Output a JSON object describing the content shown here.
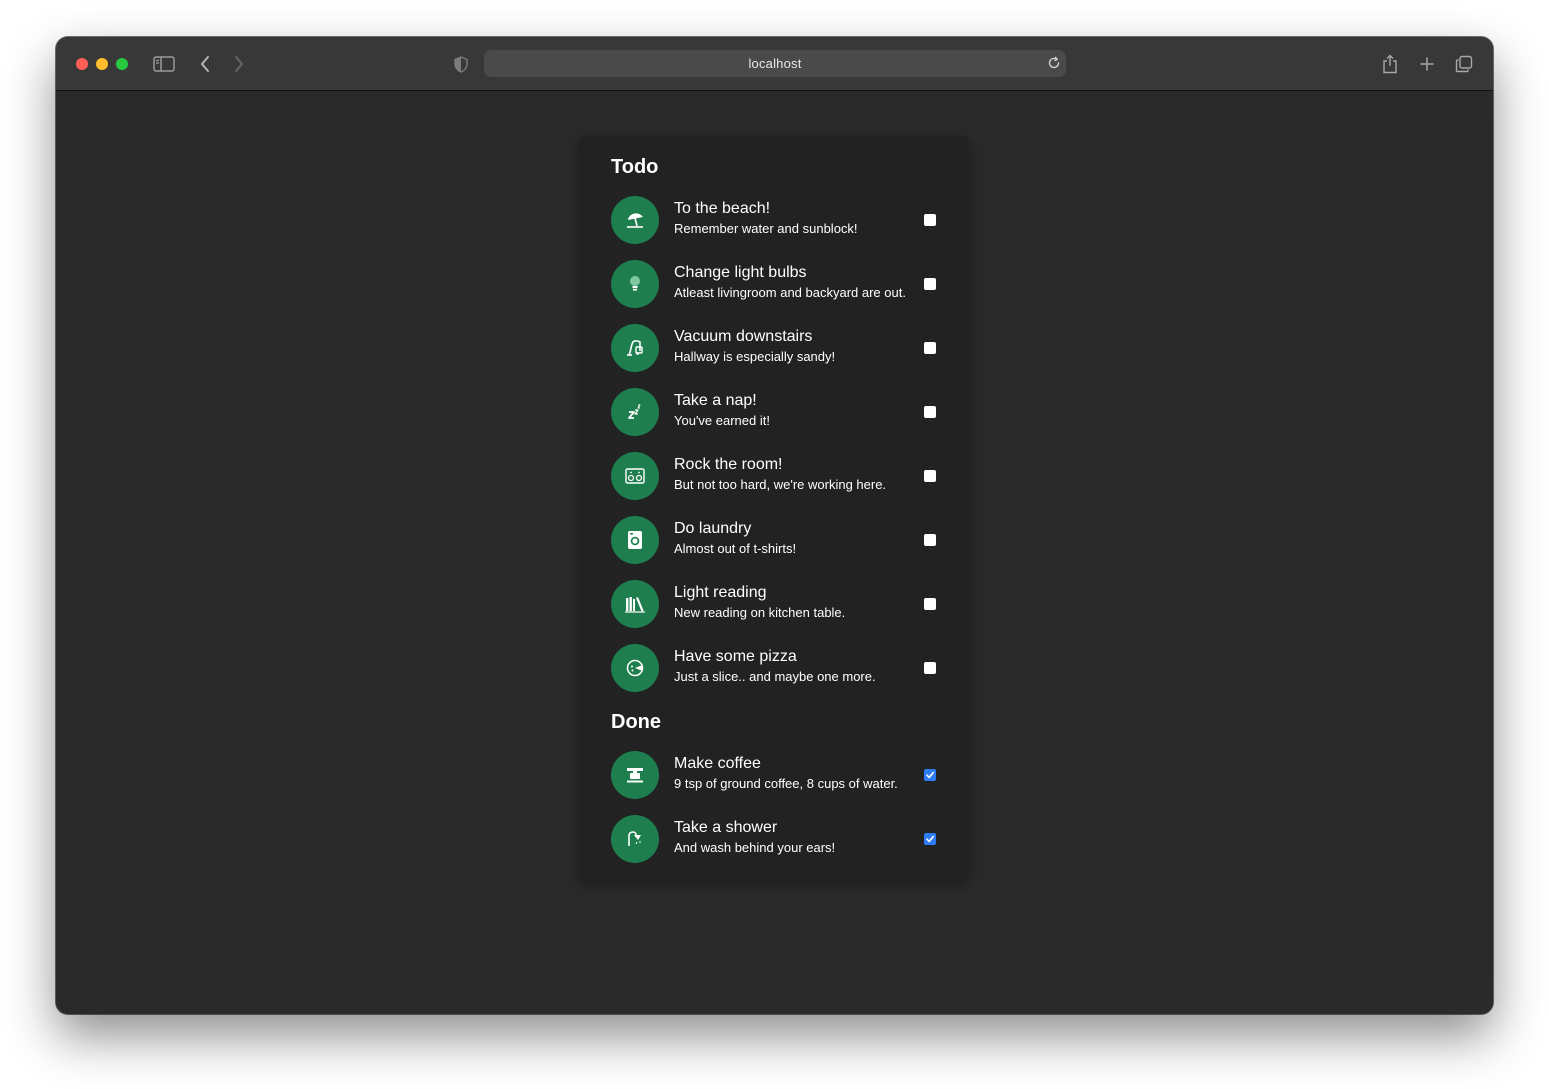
{
  "browser": {
    "url": "localhost"
  },
  "sections": {
    "todo_title": "Todo",
    "done_title": "Done"
  },
  "todo": [
    {
      "title": "To the beach!",
      "subtitle": "Remember water and sunblock!",
      "icon": "beach-umbrella-icon",
      "checked": false
    },
    {
      "title": "Change light bulbs",
      "subtitle": "Atleast livingroom and backyard are out.",
      "icon": "lightbulb-icon",
      "checked": false
    },
    {
      "title": "Vacuum downstairs",
      "subtitle": "Hallway is especially sandy!",
      "icon": "vacuum-icon",
      "checked": false
    },
    {
      "title": "Take a nap!",
      "subtitle": "You've earned it!",
      "icon": "sleep-icon",
      "checked": false
    },
    {
      "title": "Rock the room!",
      "subtitle": "But not too hard, we're working here.",
      "icon": "speaker-icon",
      "checked": false
    },
    {
      "title": "Do laundry",
      "subtitle": "Almost out of t-shirts!",
      "icon": "washing-machine-icon",
      "checked": false
    },
    {
      "title": "Light reading",
      "subtitle": "New reading on kitchen table.",
      "icon": "books-icon",
      "checked": false
    },
    {
      "title": "Have some pizza",
      "subtitle": "Just a slice.. and maybe one more.",
      "icon": "pizza-icon",
      "checked": false
    }
  ],
  "done": [
    {
      "title": "Make coffee",
      "subtitle": "9 tsp of ground coffee, 8 cups of water.",
      "icon": "coffee-maker-icon",
      "checked": true
    },
    {
      "title": "Take a shower",
      "subtitle": "And wash behind your ears!",
      "icon": "shower-icon",
      "checked": true
    }
  ],
  "colors": {
    "accent_green": "#1f7e4e",
    "checkbox_blue": "#2e7cf6",
    "card_bg": "#222222",
    "page_bg": "#2a2a2a"
  }
}
